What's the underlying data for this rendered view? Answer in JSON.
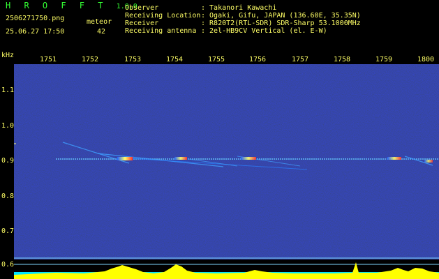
{
  "header": {
    "app_title": "H R O F F T",
    "app_version": "1.0.0",
    "filename": "2506271750.png",
    "datetime": "25.06.27 17:50",
    "meteor_label": "meteor",
    "meteor_count": "42",
    "info": [
      {
        "label": "Observer",
        "value": ": Takanori Kawachi"
      },
      {
        "label": "Receiving Location",
        "value": ": Ogaki, Gifu, JAPAN (136.60E, 35.35N)"
      },
      {
        "label": "Receiver",
        "value": ": R820T2(RTL-SDR) SDR-Sharp 53.1000MHz"
      },
      {
        "label": "Receiving antenna",
        "value": ": 2el-HB9CV Vertical (el. E-W)"
      }
    ]
  },
  "axis": {
    "y_unit": "kHz",
    "time_ticks": [
      "1751",
      "1752",
      "1753",
      "1754",
      "1755",
      "1756",
      "1757",
      "1758",
      "1759",
      "1800"
    ],
    "freq_ticks": [
      "1.1",
      "1.0",
      "0.9",
      "0.8",
      "0.7",
      "0.6"
    ]
  },
  "colors": {
    "background": "#000000",
    "text_yellow": "#ffff66",
    "text_green": "#33ff33",
    "noise_base": "#0a1060",
    "carrier": "#66ccff",
    "meteor_hot": "#ffff66",
    "activity_bar": "#ffff00",
    "baseline": "#00ffff"
  }
}
